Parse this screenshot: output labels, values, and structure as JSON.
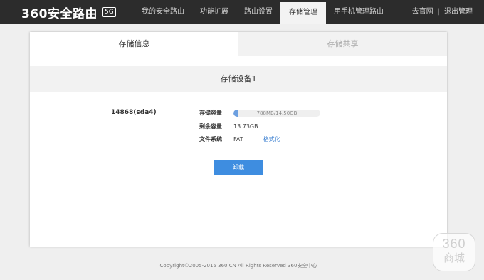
{
  "header": {
    "logo_text": "360安全路由",
    "logo_badge": "5G",
    "nav": [
      {
        "label": "我的安全路由",
        "active": false
      },
      {
        "label": "功能扩展",
        "active": false
      },
      {
        "label": "路由设置",
        "active": false
      },
      {
        "label": "存储管理",
        "active": true
      },
      {
        "label": "用手机管理路由",
        "active": false
      }
    ],
    "official_site": "去官网",
    "separator": "|",
    "logout": "退出管理"
  },
  "tabs": [
    {
      "label": "存储信息",
      "active": true
    },
    {
      "label": "存储共享",
      "active": false
    }
  ],
  "device": {
    "section_title": "存储设备1",
    "name": "14868(sda4)",
    "capacity_label": "存储容量",
    "capacity_text": "788MB/14.50GB",
    "capacity_fraction": 0.053,
    "remaining_label": "剩余容量",
    "remaining_value": "13.73GB",
    "fs_label": "文件系统",
    "fs_value": "FAT",
    "format_link": "格式化",
    "unmount_button": "卸载"
  },
  "footer": {
    "copyright": "Copyright©2005-2015 360.CN All Rights Reserved 360安全中心"
  },
  "watermark": {
    "line1": "360",
    "line2": "商城"
  },
  "colors": {
    "topbar": "#2c2c2c",
    "accent": "#3e8de0",
    "bar_fill": "#6c9fe0",
    "link": "#3f82d1"
  }
}
